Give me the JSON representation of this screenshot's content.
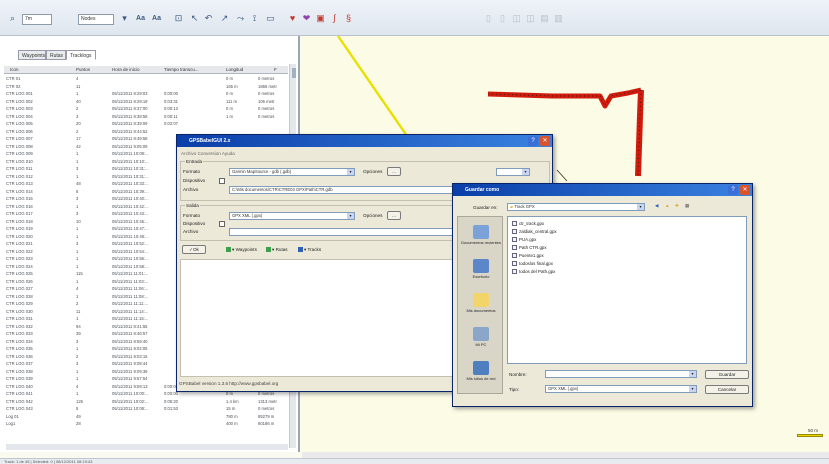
{
  "toolbar": {
    "combo1": "7m",
    "combo2": "Nodes",
    "font_btn": "Aa",
    "font_btn2": "Aa"
  },
  "left_panel": {
    "tabs": [
      "Waypoints",
      "Rutas",
      "Tracklogs"
    ],
    "columns": [
      "Icon",
      "Puntos",
      "Hora de inicio",
      "Tiempo transcu...",
      "Longitud",
      "F"
    ],
    "rows": [
      [
        "CTR 01",
        "4",
        "",
        "",
        "0 m",
        "0 metros"
      ],
      [
        "CTR 02",
        "11",
        "",
        "",
        "165 m",
        "1866 metr"
      ],
      [
        "CTR LOG 001",
        "1",
        "05/11/2011 8:29:03",
        "0:00:00",
        "0 m",
        "0 metros"
      ],
      [
        "CTR LOG 002",
        "40",
        "05/11/2011 8:29:19",
        "0:03:31",
        "111 m",
        "106 metr"
      ],
      [
        "CTR LOG 003",
        "2",
        "05/11/2011 8:37:00",
        "0:00:13",
        "0 m",
        "0 metros"
      ],
      [
        "CTR LOG 004",
        "3",
        "05/11/2011 8:38:58",
        "0:00:11",
        "1 m",
        "0 metros"
      ],
      [
        "CTR LOG 005",
        "20",
        "05/11/2011 8:39:09",
        "0:02:07",
        "",
        ""
      ],
      [
        "CTR LOG 006",
        "2",
        "05/11/2011 8:44:52",
        "",
        "",
        ""
      ],
      [
        "CTR LOG 007",
        "17",
        "05/11/2011 8:49:58",
        "",
        "",
        ""
      ],
      [
        "CTR LOG 008",
        "42",
        "05/11/2011 9:05:09",
        "",
        "",
        ""
      ],
      [
        "CTR LOG 009",
        "1",
        "05/11/2011 10:08:...",
        "",
        "",
        ""
      ],
      [
        "CTR LOG 010",
        "1",
        "05/11/2011 10:10:...",
        "",
        "",
        ""
      ],
      [
        "CTR LOG 011",
        "3",
        "05/11/2011 10:31:...",
        "",
        "",
        ""
      ],
      [
        "CTR LOG 012",
        "1",
        "05/11/2011 10:31:...",
        "",
        "",
        ""
      ],
      [
        "CTR LOG 013",
        "48",
        "05/11/2011 10:33:...",
        "",
        "",
        ""
      ],
      [
        "CTR LOG 014",
        "6",
        "05/11/2011 10:39:...",
        "",
        "",
        ""
      ],
      [
        "CTR LOG 015",
        "3",
        "05/11/2011 10:40:...",
        "",
        "",
        ""
      ],
      [
        "CTR LOG 016",
        "1",
        "05/11/2011 10:42:...",
        "",
        "",
        ""
      ],
      [
        "CTR LOG 017",
        "3",
        "05/11/2011 10:43:...",
        "",
        "",
        ""
      ],
      [
        "CTR LOG 018",
        "10",
        "05/11/2011 10:45:...",
        "",
        "",
        ""
      ],
      [
        "CTR LOG 019",
        "1",
        "05/11/2011 10:47:...",
        "",
        "",
        ""
      ],
      [
        "CTR LOG 020",
        "1",
        "05/11/2011 10:48:...",
        "",
        "",
        ""
      ],
      [
        "CTR LOG 021",
        "3",
        "05/11/2011 10:52:...",
        "",
        "",
        ""
      ],
      [
        "CTR LOG 022",
        "1",
        "05/11/2011 10:54:...",
        "",
        "",
        ""
      ],
      [
        "CTR LOG 023",
        "1",
        "05/11/2011 10:56:...",
        "",
        "",
        ""
      ],
      [
        "CTR LOG 024",
        "1",
        "05/11/2011 10:58:...",
        "",
        "",
        ""
      ],
      [
        "CTR LOG 025",
        "115",
        "05/11/2011 11:01:...",
        "",
        "",
        ""
      ],
      [
        "CTR LOG 026",
        "1",
        "05/11/2011 11:03:...",
        "",
        "",
        ""
      ],
      [
        "CTR LOG 027",
        "4",
        "05/11/2011 11:06:...",
        "",
        "",
        ""
      ],
      [
        "CTR LOG 028",
        "1",
        "05/11/2011 11:08:...",
        "",
        "",
        ""
      ],
      [
        "CTR LOG 029",
        "2",
        "05/11/2011 11:11:...",
        "",
        "",
        ""
      ],
      [
        "CTR LOG 030",
        "11",
        "05/11/2011 11:14:...",
        "",
        "",
        ""
      ],
      [
        "CTR LOG 031",
        "1",
        "05/11/2011 11:15:...",
        "",
        "",
        ""
      ],
      [
        "CTR LOG 032",
        "94",
        "05/11/2011 8:41:55",
        "",
        "",
        ""
      ],
      [
        "CTR LOG 033",
        "39",
        "05/11/2011 8:46:57",
        "",
        "",
        ""
      ],
      [
        "CTR LOG 034",
        "3",
        "05/11/2011 8:59:40",
        "",
        "",
        ""
      ],
      [
        "CTR LOG 035",
        "1",
        "05/11/2011 9:02:05",
        "",
        "",
        ""
      ],
      [
        "CTR LOG 036",
        "2",
        "05/11/2011 9:03:15",
        "",
        "",
        ""
      ],
      [
        "CTR LOG 037",
        "3",
        "05/11/2011 9:08:44",
        "",
        "",
        ""
      ],
      [
        "CTR LOG 038",
        "1",
        "05/11/2011 9:09:39",
        "",
        "",
        ""
      ],
      [
        "CTR LOG 039",
        "1",
        "05/11/2011 9:57:54",
        "",
        "",
        ""
      ],
      [
        "CTR LOG 040",
        "4",
        "05/11/2011 9:59:13",
        "0:00:00",
        "0 m",
        "0 metros"
      ],
      [
        "CTR LOG 041",
        "1",
        "05/11/2011 10:00:...",
        "0:00:00",
        "0 m",
        "0 metros"
      ],
      [
        "CTR LOG 042",
        "126",
        "05/11/2011 10:02:...",
        "0:05:20",
        "1.4 km",
        "1313 metr"
      ],
      [
        "CTR LOG 043",
        "5",
        "05/11/2011 10:08:...",
        "0:01:53",
        "15 m",
        "0 metros"
      ],
      [
        "Log 01",
        "49",
        "",
        "",
        "780 m",
        "85279 m"
      ],
      [
        "Log1",
        "28",
        "",
        "",
        "400 m",
        "60186 m"
      ]
    ]
  },
  "status_bar": "Track: 1 de 45 | Selected: 0 | 08/12/2011 08:19:43",
  "scale_label": "50 m",
  "gps_dialog": {
    "title": "GPSBabelGUI 2.x",
    "menu": "Archivo  Conversion  Ayuda",
    "entrada_label": "Entrada",
    "formato_label": "Formato",
    "dispositivo_label": "Dispositivo",
    "archivo_label": "Archivo",
    "input_format": "Garmin MapSource - gdb (.gdb)",
    "input_file": "C:\\Mis documentos\\CTR\\CTRE03 GPX\\Path\\CTR.gdb",
    "opciones": "Opciones",
    "salida_label": "Salida",
    "output_format": "GPX XML (.gpx)",
    "output_file": "",
    "ok_label": "Ok",
    "waypoints_label": "Waypoints",
    "routes_label": "Rutas",
    "tracks_label": "Tracks",
    "status": "GPSBabel version 1.3.6 http://www.gpsbabel.org"
  },
  "save_dialog": {
    "title": "Guardar como",
    "save_in_label": "Guardar en:",
    "save_in_value": "Track GPX",
    "places": [
      "Documentos recientes",
      "Escritorio",
      "Mis documentos",
      "Mi PC",
      "Mis sitios de red"
    ],
    "files": [
      "ctr_track.gpx",
      "zaldiak_central.gpx",
      "PUA.gpx",
      "Path CTR.gpx",
      "Puente1.gpx",
      "todoslos final.gpx",
      "todos del Path.gpx"
    ],
    "filename_label": "Nombre:",
    "filename_value": "",
    "type_label": "Tipo:",
    "type_value": "GPX XML (.gpx)",
    "save_btn": "Guardar",
    "cancel_btn": "Cancelar"
  },
  "colors": {
    "track_red": "#d21a0c",
    "track_yellow": "#e8e000",
    "dialog_title": "#0a3ea8"
  }
}
